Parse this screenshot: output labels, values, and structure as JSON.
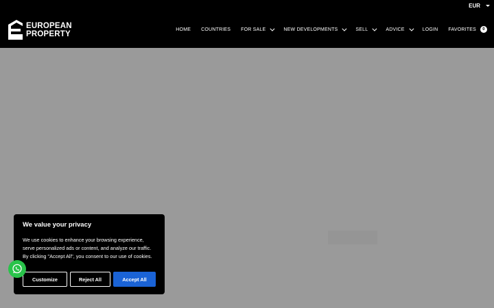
{
  "header": {
    "currency": "EUR",
    "logo": {
      "line1": "EUROPEAN",
      "line2": "PROPERTY"
    },
    "nav": [
      {
        "label": "HOME",
        "dropdown": false
      },
      {
        "label": "COUNTRIES",
        "dropdown": false
      },
      {
        "label": "FOR SALE",
        "dropdown": true
      },
      {
        "label": "NEW DEVELOPMENTS",
        "dropdown": true
      },
      {
        "label": "SELL",
        "dropdown": true
      },
      {
        "label": "ADVICE",
        "dropdown": true
      },
      {
        "label": "LOGIN",
        "dropdown": false
      }
    ],
    "favorites": {
      "label": "FAVORITES",
      "count": "0"
    }
  },
  "cookie_banner": {
    "title": "We value your privacy",
    "text": "We use cookies to enhance your browsing experience, serve personalized ads or content, and analyze our traffic. By clicking \"Accept All\", you consent to our use of cookies.",
    "buttons": {
      "customize": "Customize",
      "reject": "Reject All",
      "accept": "Accept All"
    }
  },
  "colors": {
    "header_bg": "#000000",
    "overlay_bg": "#9a9a9a",
    "accept_button": "#1a63d6",
    "whatsapp": "#29c34a"
  },
  "icons": {
    "logo": "european-property-logo-icon",
    "whatsapp": "whatsapp-icon",
    "chevron": "chevron-down-icon"
  }
}
